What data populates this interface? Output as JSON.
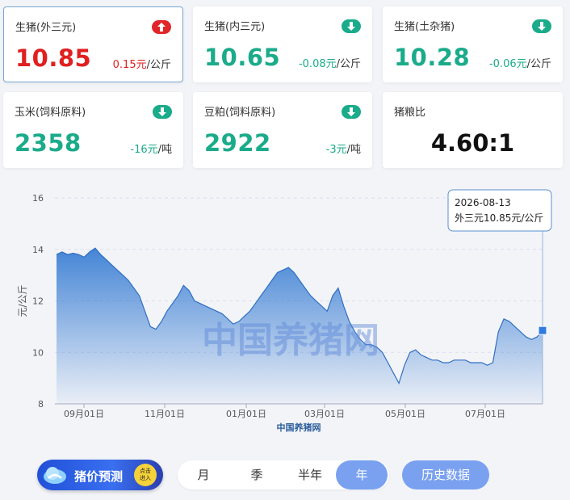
{
  "cards": [
    {
      "label": "生猪(外三元)",
      "value": "10.85",
      "change": "0.15元",
      "unit": "/公斤",
      "dir": "up"
    },
    {
      "label": "生猪(内三元)",
      "value": "10.65",
      "change": "-0.08元",
      "unit": "/公斤",
      "dir": "down"
    },
    {
      "label": "生猪(土杂猪)",
      "value": "10.28",
      "change": "-0.06元",
      "unit": "/公斤",
      "dir": "down"
    },
    {
      "label": "玉米(饲料原料)",
      "value": "2358",
      "change": "-16元",
      "unit": "/吨",
      "dir": "down"
    },
    {
      "label": "豆粕(饲料原料)",
      "value": "2922",
      "change": "-3元",
      "unit": "/吨",
      "dir": "down"
    },
    {
      "label": "猪粮比",
      "value": "4.60:1"
    }
  ],
  "colors": {
    "up": "#e02020",
    "down": "#1aab8a",
    "accent": "#7aa1f0",
    "series": "#3b7fd4"
  },
  "chart_data": {
    "type": "area",
    "ylabel": "元/公斤",
    "xlabel": "中国养猪网",
    "watermark": "中国养猪网",
    "ylim": [
      8,
      16
    ],
    "yticks": [
      8,
      10,
      12,
      14,
      16
    ],
    "xticks": [
      "09月01日",
      "11月01日",
      "01月01日",
      "03月01日",
      "05月01日",
      "07月01日"
    ],
    "grid": true,
    "tooltip": {
      "date": "2026-08-13",
      "text": "外三元10.85元/公斤"
    },
    "series": [
      {
        "values": [
          13.8,
          13.9,
          13.8,
          13.85,
          13.8,
          13.7,
          13.9,
          14.05,
          13.8,
          13.6,
          13.4,
          13.2,
          13.0,
          12.8,
          12.5,
          12.2,
          11.6,
          11.0,
          10.9,
          11.2,
          11.6,
          11.9,
          12.2,
          12.6,
          12.4,
          12.0,
          11.9,
          11.8,
          11.7,
          11.6,
          11.5,
          11.3,
          11.1,
          11.2,
          11.4,
          11.6,
          11.9,
          12.2,
          12.5,
          12.8,
          13.1,
          13.2,
          13.3,
          13.1,
          12.8,
          12.5,
          12.2,
          12.0,
          11.8,
          11.6,
          12.2,
          12.5,
          11.8,
          11.2,
          10.8,
          10.5,
          10.3,
          10.3,
          10.2,
          10.0,
          9.6,
          9.2,
          8.8,
          9.5,
          10.0,
          10.1,
          9.9,
          9.8,
          9.7,
          9.7,
          9.6,
          9.6,
          9.7,
          9.7,
          9.7,
          9.6,
          9.6,
          9.6,
          9.5,
          9.6,
          10.8,
          11.3,
          11.2,
          11.0,
          10.8,
          10.6,
          10.5,
          10.6,
          10.85
        ]
      }
    ]
  },
  "bottom": {
    "badge": "猪价预测",
    "badge_go_1": "点击",
    "badge_go_2": "进入",
    "tabs": [
      "月",
      "季",
      "半年",
      "年"
    ],
    "active_tab": "年",
    "history": "历史数据"
  }
}
